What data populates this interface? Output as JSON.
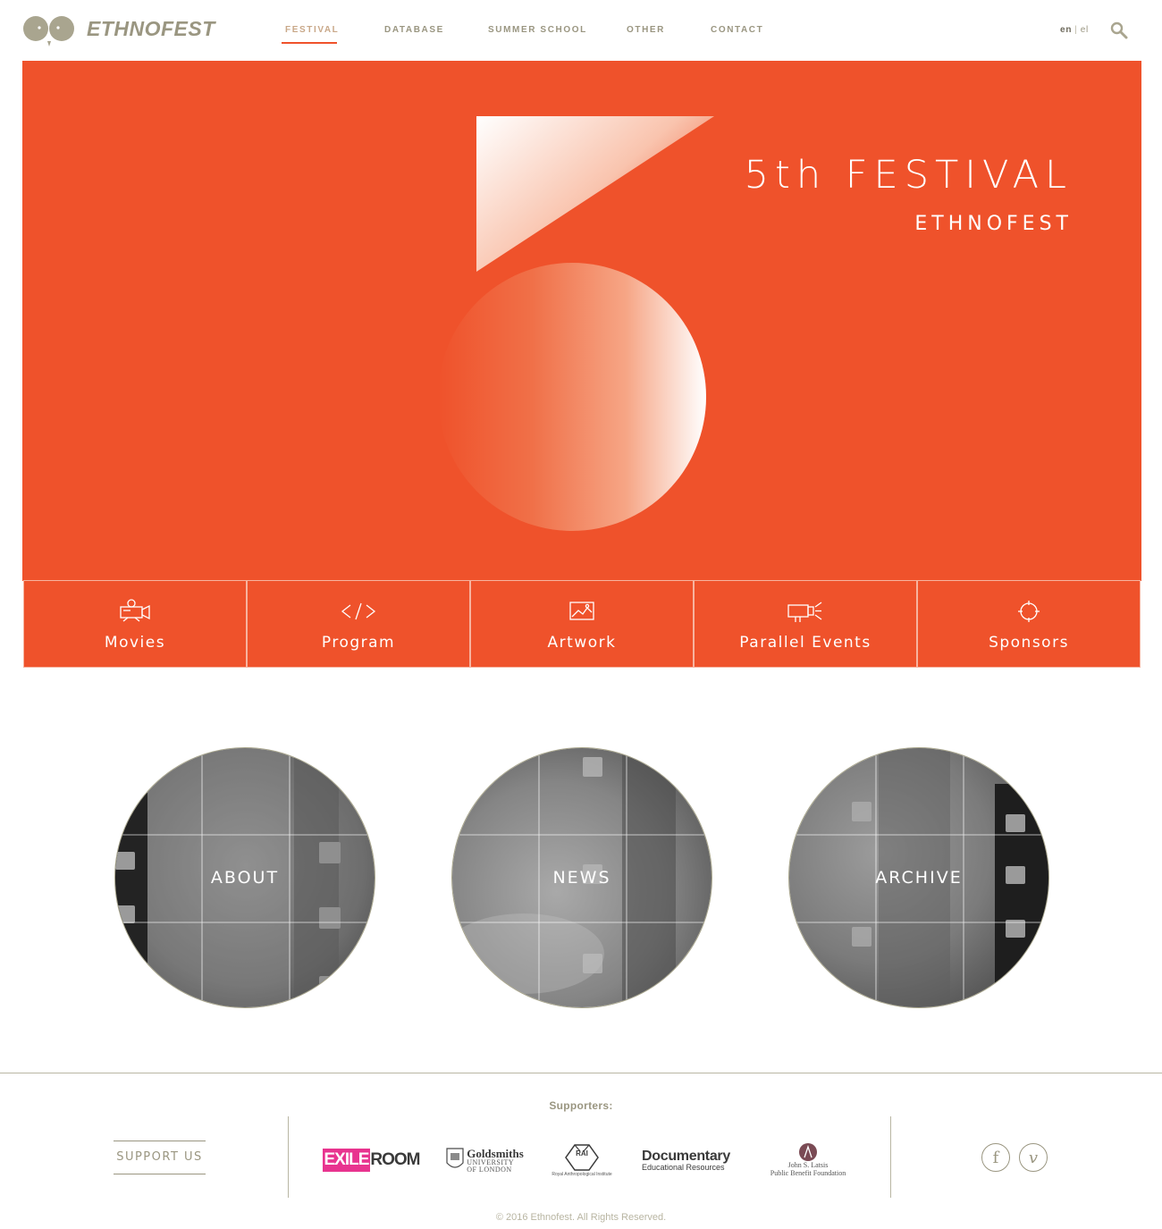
{
  "brand": {
    "name": "ETHNOFEST"
  },
  "nav": {
    "items": [
      {
        "label": "FESTIVAL",
        "active": true
      },
      {
        "label": "DATABASE",
        "active": false
      },
      {
        "label": "SUMMER SCHOOL",
        "active": false
      },
      {
        "label": "OTHER",
        "active": false
      },
      {
        "label": "CONTACT",
        "active": false
      }
    ]
  },
  "lang": {
    "current": "en",
    "separator": "|",
    "other": "el"
  },
  "hero": {
    "title": "5th FESTIVAL",
    "subtitle": "ETHNOFEST",
    "bg_color": "#ef522b"
  },
  "tiles": [
    {
      "label": "Movies",
      "icon": "camera-icon"
    },
    {
      "label": "Program",
      "icon": "code-icon"
    },
    {
      "label": "Artwork",
      "icon": "image-icon"
    },
    {
      "label": "Parallel Events",
      "icon": "projector-icon"
    },
    {
      "label": "Sponsors",
      "icon": "target-icon"
    }
  ],
  "circles": [
    {
      "label": "ABOUT"
    },
    {
      "label": "NEWS"
    },
    {
      "label": "ARCHIVE"
    }
  ],
  "footer": {
    "supporters_label": "Supporters:",
    "support_button": "SUPPORT US",
    "sponsors": [
      {
        "name": "EXILEROOM",
        "part1": "EXILE",
        "part2": "ROOM"
      },
      {
        "name": "Goldsmiths University of London",
        "line1": "Goldsmiths",
        "line2": "UNIVERSITY",
        "line3": "OF LONDON"
      },
      {
        "name": "Royal Anthropological Institute",
        "mark": "RAI",
        "caption": "Royal Anthropological Institute"
      },
      {
        "name": "Documentary Educational Resources",
        "line1": "Documentary",
        "line2": "Educational Resources"
      },
      {
        "name": "John S. Latsis Public Benefit Foundation",
        "line1": "John S. Latsis",
        "line2": "Public Benefit Foundation"
      }
    ],
    "social": [
      {
        "name": "facebook",
        "glyph": "f"
      },
      {
        "name": "vimeo",
        "glyph": "v"
      }
    ],
    "copyright": "© 2016 Ethnofest. All Rights Reserved."
  },
  "colors": {
    "accent": "#ef522b",
    "text_muted": "#9a9681",
    "white": "#ffffff"
  }
}
